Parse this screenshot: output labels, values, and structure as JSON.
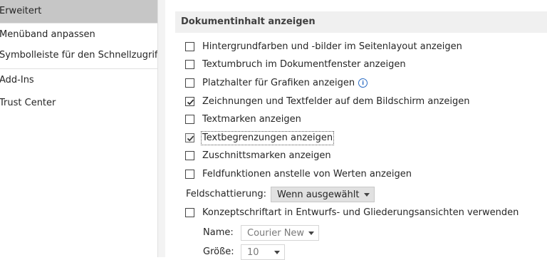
{
  "nav": {
    "items": [
      {
        "label": "Erweitert",
        "selected": true
      },
      {
        "label": "Menüband anpassen",
        "selected": false
      },
      {
        "label": "Symbolleiste für den Schnellzugriff",
        "selected": false
      },
      {
        "label": "Add-Ins",
        "selected": false
      },
      {
        "label": "Trust Center",
        "selected": false
      }
    ]
  },
  "section": {
    "title": "Dokumentinhalt anzeigen"
  },
  "options": [
    {
      "label": "Hintergrundfarben und -bilder im Seitenlayout anzeigen",
      "checked": false
    },
    {
      "label": "Textumbruch im Dokumentfenster anzeigen",
      "checked": false
    },
    {
      "label": "Platzhalter für Grafiken anzeigen",
      "checked": false,
      "info_icon": "info-icon"
    },
    {
      "label": "Zeichnungen und Textfelder auf dem Bildschirm anzeigen",
      "checked": true
    },
    {
      "label": "Textmarken anzeigen",
      "checked": false
    },
    {
      "label": "Textbegrenzungen anzeigen",
      "checked": true
    },
    {
      "label": "Zuschnittsmarken anzeigen",
      "checked": false
    },
    {
      "label": "Feldfunktionen anstelle von Werten anzeigen",
      "checked": false
    }
  ],
  "field_shading": {
    "label": "Feldschattierung:",
    "value": "Wenn ausgewählt"
  },
  "draft_font": {
    "label": "Konzeptschriftart in Entwurfs- und Gliederungsansichten verwenden",
    "checked": false,
    "name_label": "Name:",
    "name_value": "Courier New",
    "size_label": "Größe:",
    "size_value": "10"
  },
  "colors": {
    "selected_nav": "#c6c6c6",
    "section_header": "#f0f0f0",
    "dropdown_bg": "#e1e1e1",
    "info_blue": "#2b6cc4"
  }
}
